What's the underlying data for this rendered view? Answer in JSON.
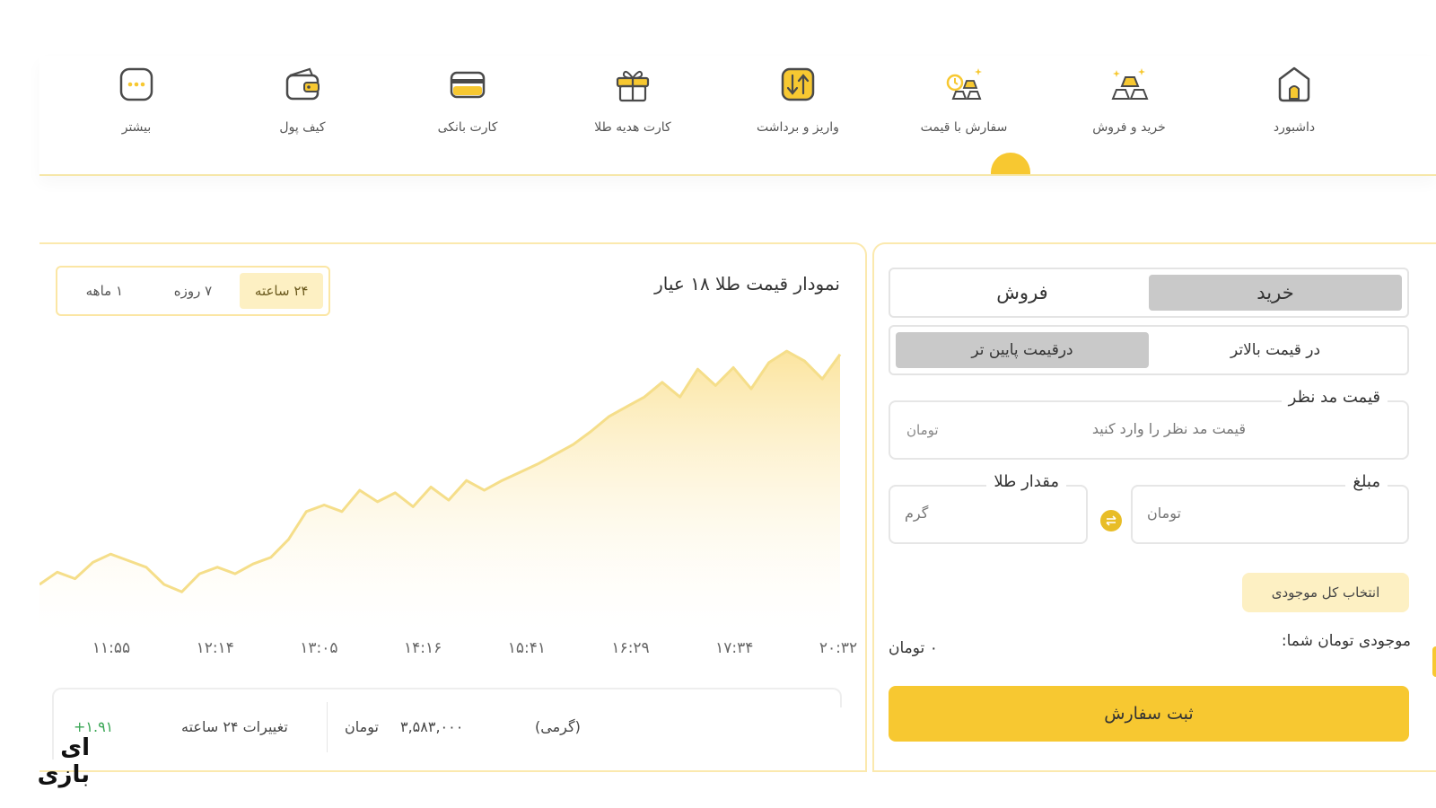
{
  "nav": {
    "items": [
      {
        "label": "داشبورد",
        "icon": "home-icon"
      },
      {
        "label": "خرید و فروش",
        "icon": "gold-bars-icon"
      },
      {
        "label": "سفارش با قیمت",
        "icon": "gold-order-icon"
      },
      {
        "label": "واریز و برداشت",
        "icon": "transfer-icon"
      },
      {
        "label": "کارت هدیه طلا",
        "icon": "gift-icon"
      },
      {
        "label": "کارت بانکی",
        "icon": "bank-card-icon"
      },
      {
        "label": "کیف پول",
        "icon": "wallet-icon"
      },
      {
        "label": "بیشتر",
        "icon": "more-icon"
      }
    ],
    "active": "سفارش با قیمت"
  },
  "chart": {
    "title": "نمودار قیمت طلا ۱۸ عیار",
    "ranges": [
      "۲۴ ساعته",
      "۷ روزه",
      "۱ ماهه"
    ],
    "active_range": "۲۴ ساعته",
    "stats": {
      "change_label": "تغییرات ۲۴ ساعته",
      "change_value": "+۱.۹۱",
      "price_value": "۳,۵۸۳,۰۰۰",
      "price_unit": "تومان",
      "per_unit": "(گرمی)"
    }
  },
  "chart_data": {
    "type": "area",
    "title": "نمودار قیمت طلا ۱۸ عیار",
    "x_ticks": [
      "۱۱:۵۵",
      "۱۲:۱۴",
      "۱۳:۰۵",
      "۱۴:۱۶",
      "۱۵:۴۱",
      "۱۶:۲۹",
      "۱۷:۳۴",
      "۲۰:۳۲"
    ],
    "values": [
      45,
      60,
      52,
      72,
      82,
      74,
      66,
      45,
      36,
      58,
      66,
      58,
      70,
      78,
      100,
      134,
      142,
      134,
      160,
      146,
      157,
      140,
      164,
      148,
      172,
      160,
      172,
      182,
      192,
      204,
      216,
      232,
      250,
      262,
      274,
      292,
      274,
      308,
      288,
      310,
      284,
      316,
      330,
      318,
      296,
      326
    ],
    "xlabel": "",
    "ylabel": "",
    "grid": false,
    "fill_color": "#fbe7a0",
    "line_color": "#f5de8a"
  },
  "order": {
    "side_tabs": [
      "خرید",
      "فروش"
    ],
    "active_side": "خرید",
    "price_tabs": [
      "در قیمت بالاتر",
      "درقیمت پایین تر"
    ],
    "active_price_tab": "درقیمت پایین تر",
    "target_price": {
      "label": "قیمت مد نظر",
      "placeholder": "قیمت مد نظر را وارد کنید",
      "unit": "تومان"
    },
    "amount": {
      "label": "مبلغ",
      "placeholder": "تومان"
    },
    "gold_amount": {
      "label": "مقدار طلا",
      "placeholder": "گرم"
    },
    "select_all": "انتخاب کل موجودی",
    "balance_label": "موجودی تومان شما:",
    "balance_value": "۰ تومان",
    "submit": "ثبت سفارش"
  },
  "colors": {
    "accent": "#f7c831",
    "accent_light": "#fdf0c3",
    "border_gold": "#fbe9ae"
  },
  "watermark": {
    "text": "ای بازی"
  }
}
